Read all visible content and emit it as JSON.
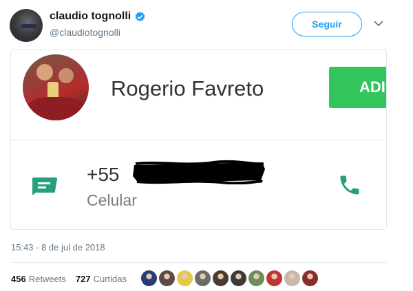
{
  "tweet": {
    "author_name": "claudio tognolli",
    "author_handle": "@claudiotognolli",
    "follow_label": "Seguir",
    "timestamp": "15:43 - 8 de jul de 2018"
  },
  "contact_card": {
    "name": "Rogerio Favreto",
    "add_label": "ADI",
    "phone_number": "+55",
    "phone_type": "Celular",
    "accent_color": "#31c55c",
    "icon_color": "#26a07c"
  },
  "stats": {
    "retweets_count": "456",
    "retweets_label": "Retweets",
    "likes_count": "727",
    "likes_label": "Curtidas"
  },
  "likers": [
    {
      "color": "#263e74"
    },
    {
      "color": "#5b4a45"
    },
    {
      "color": "#e2c94a"
    },
    {
      "color": "#6b6b6b"
    },
    {
      "color": "#4a3a32"
    },
    {
      "color": "#3b3b3b"
    },
    {
      "color": "#6a8e5a"
    },
    {
      "color": "#c23333"
    },
    {
      "color": "#c8b8a8"
    },
    {
      "color": "#8a2e2a"
    }
  ],
  "icons": {
    "verified": "verified-badge-icon",
    "chevron": "chevron-down-icon",
    "message": "message-icon",
    "phone": "phone-icon"
  }
}
